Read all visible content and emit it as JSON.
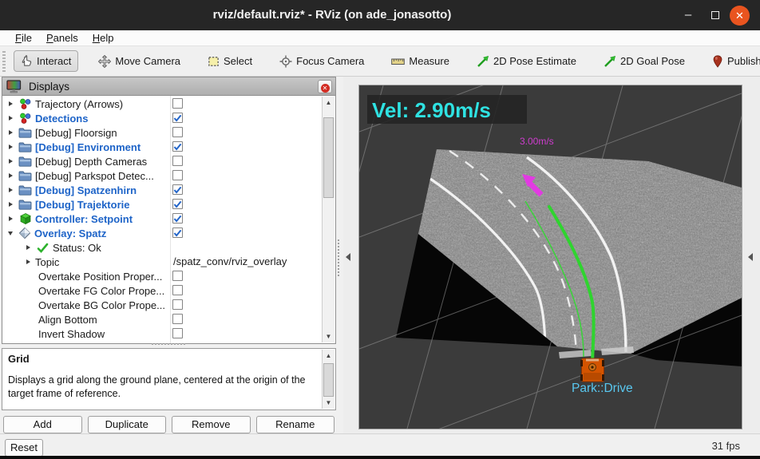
{
  "window": {
    "title": "rviz/default.rviz* - RViz (on ade_jonasotto)",
    "minimize_glyph": "–",
    "close_glyph": "✕"
  },
  "menu": {
    "items": [
      {
        "label": "File"
      },
      {
        "label": "Panels"
      },
      {
        "label": "Help"
      }
    ]
  },
  "toolbar": {
    "buttons": [
      {
        "name": "interact",
        "label": "Interact",
        "icon": "hand-icon",
        "active": true
      },
      {
        "name": "move-camera",
        "label": "Move Camera",
        "icon": "move-camera-icon",
        "active": false
      },
      {
        "name": "select",
        "label": "Select",
        "icon": "select-icon",
        "active": false
      },
      {
        "name": "focus-camera",
        "label": "Focus Camera",
        "icon": "focus-icon",
        "active": false
      },
      {
        "name": "measure",
        "label": "Measure",
        "icon": "measure-icon",
        "active": false
      },
      {
        "name": "pose-estimate",
        "label": "2D Pose Estimate",
        "icon": "pose-arrow-icon",
        "active": false
      },
      {
        "name": "goal-pose",
        "label": "2D Goal Pose",
        "icon": "goal-arrow-icon",
        "active": false
      },
      {
        "name": "publish-point",
        "label": "Publish Point",
        "icon": "pin-icon",
        "active": false
      },
      {
        "name": "add-tool",
        "label": "",
        "icon": "plus-icon",
        "active": false
      }
    ],
    "overflow_label": "»"
  },
  "displays_panel": {
    "title": "Displays",
    "tree": [
      {
        "label": "Trajectory (Arrows)",
        "icon": "markers-icon",
        "arrow": "collapsed",
        "depth": 0,
        "checked": false,
        "enabled_style": false
      },
      {
        "label": "Detections",
        "icon": "markers-icon",
        "arrow": "collapsed",
        "depth": 0,
        "checked": true,
        "enabled_style": true
      },
      {
        "label": "[Debug] Floorsign",
        "icon": "folder-icon",
        "arrow": "collapsed",
        "depth": 0,
        "checked": false,
        "enabled_style": false
      },
      {
        "label": "[Debug] Environment",
        "icon": "folder-icon",
        "arrow": "collapsed",
        "depth": 0,
        "checked": true,
        "enabled_style": true
      },
      {
        "label": "[Debug] Depth Cameras",
        "icon": "folder-icon",
        "arrow": "collapsed",
        "depth": 0,
        "checked": false,
        "enabled_style": false
      },
      {
        "label": "[Debug] Parkspot Detec...",
        "icon": "folder-icon",
        "arrow": "collapsed",
        "depth": 0,
        "checked": false,
        "enabled_style": false
      },
      {
        "label": "[Debug] Spatzenhirn",
        "icon": "folder-icon",
        "arrow": "collapsed",
        "depth": 0,
        "checked": true,
        "enabled_style": true
      },
      {
        "label": "[Debug] Trajektorie",
        "icon": "folder-icon",
        "arrow": "collapsed",
        "depth": 0,
        "checked": true,
        "enabled_style": true
      },
      {
        "label": "Controller: Setpoint",
        "icon": "cube-icon",
        "arrow": "collapsed",
        "depth": 0,
        "checked": true,
        "enabled_style": true
      },
      {
        "label": "Overlay: Spatz",
        "icon": "diamond-icon",
        "arrow": "expanded",
        "depth": 0,
        "checked": true,
        "enabled_style": true
      },
      {
        "label": "Status: Ok",
        "icon": "check-icon",
        "arrow": "collapsed",
        "depth": 1
      },
      {
        "label": "Topic",
        "arrow": "collapsed",
        "depth": 1,
        "value": "/spatz_conv/rviz_overlay"
      },
      {
        "label": "Overtake Position Proper...",
        "depth": 1,
        "checked": false
      },
      {
        "label": "Overtake FG Color Prope...",
        "depth": 1,
        "checked": false
      },
      {
        "label": "Overtake BG Color Prope...",
        "depth": 1,
        "checked": false
      },
      {
        "label": "Align Bottom",
        "depth": 1,
        "checked": false
      },
      {
        "label": "Invert Shadow",
        "depth": 1,
        "checked": false
      }
    ]
  },
  "description": {
    "title": "Grid",
    "text": "Displays a grid along the ground plane, centered at the origin of the target frame of reference."
  },
  "actions": [
    "Add",
    "Duplicate",
    "Remove",
    "Rename"
  ],
  "status": {
    "reset_label": "Reset",
    "fps_label": "31 fps"
  },
  "viewport": {
    "vel_overlay": "Vel: 2.90m/s",
    "target_speed_label": "3.00m/s",
    "state_label": "Park::Drive",
    "colors": {
      "background": "#3b3b3b",
      "overlay_cyan": "#2fe2e2",
      "speed_magenta": "#cf3ccf",
      "state_cyan": "#59c8f0",
      "trajectory_green": "#2fd42f",
      "car_orange": "#d35400",
      "enabled_item_blue": "#1e64c8",
      "close_button_orange": "#e9541f"
    }
  }
}
